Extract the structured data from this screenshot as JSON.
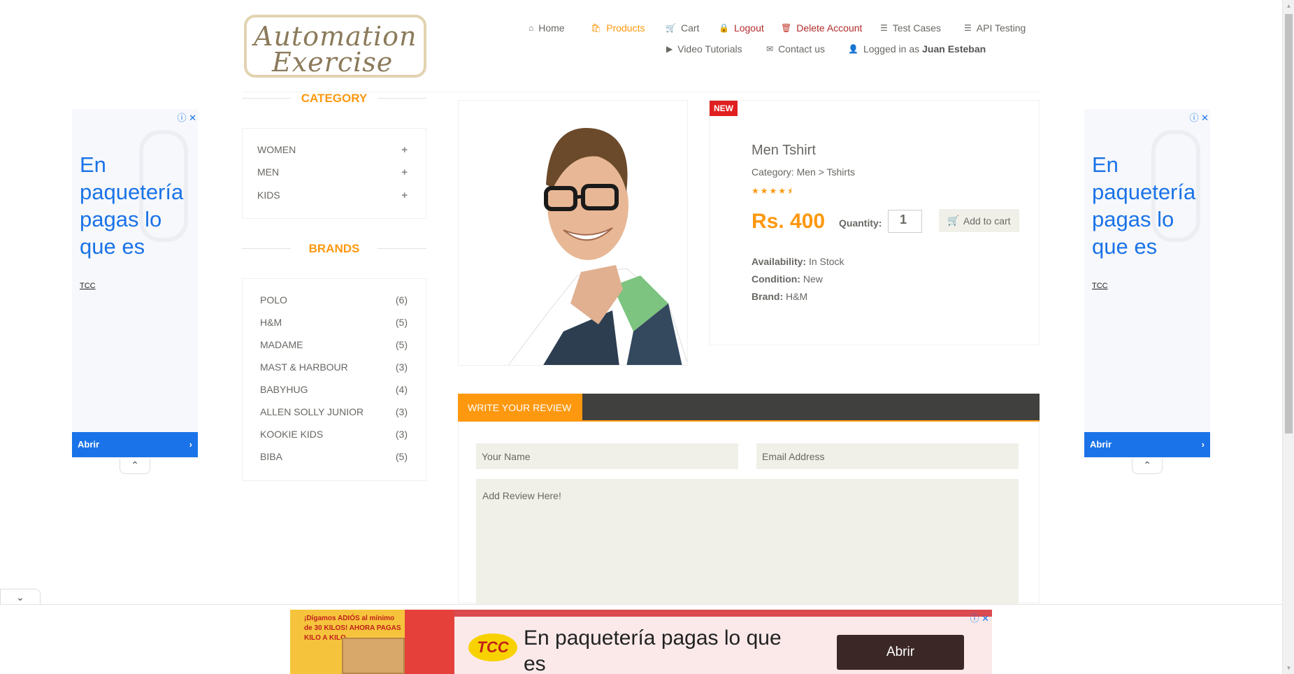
{
  "header": {
    "logo_line1": "Automation",
    "logo_line2": "Exercise",
    "nav": [
      {
        "label": "Home",
        "icon": "home-icon"
      },
      {
        "label": "Products",
        "icon": "products-icon"
      },
      {
        "label": "Cart",
        "icon": "cart-icon"
      },
      {
        "label": "Logout",
        "icon": "lock-icon"
      },
      {
        "label": "Delete Account",
        "icon": "trash-icon"
      },
      {
        "label": "Test Cases",
        "icon": "list-icon"
      },
      {
        "label": "API Testing",
        "icon": "list-icon"
      },
      {
        "label": "Video Tutorials",
        "icon": "youtube-icon"
      },
      {
        "label": "Contact us",
        "icon": "envelope-icon"
      },
      {
        "label": "Logged in as",
        "icon": "user-icon"
      }
    ],
    "username": "Juan Esteban",
    "accent_color": "#fe980f"
  },
  "sidebar": {
    "category_title": "CATEGORY",
    "categories": [
      "WOMEN",
      "MEN",
      "KIDS"
    ],
    "brands_title": "BRANDS",
    "brands": [
      {
        "name": "POLO",
        "count": "(6)"
      },
      {
        "name": "H&M",
        "count": "(5)"
      },
      {
        "name": "MADAME",
        "count": "(5)"
      },
      {
        "name": "MAST & HARBOUR",
        "count": "(3)"
      },
      {
        "name": "BABYHUG",
        "count": "(4)"
      },
      {
        "name": "ALLEN SOLLY JUNIOR",
        "count": "(3)"
      },
      {
        "name": "KOOKIE KIDS",
        "count": "(3)"
      },
      {
        "name": "BIBA",
        "count": "(5)"
      }
    ]
  },
  "product": {
    "badge": "NEW",
    "name": "Men Tshirt",
    "category": "Category: Men > Tshirts",
    "rating": 4.5,
    "price": "Rs. 400",
    "quantity_label": "Quantity:",
    "quantity": "1",
    "add_to_cart": "Add to cart",
    "availability_label": "Availability:",
    "availability": "In Stock",
    "condition_label": "Condition:",
    "condition": "New",
    "brand_label": "Brand:",
    "brand": "H&M"
  },
  "review": {
    "tab_label": "WRITE YOUR REVIEW",
    "name_placeholder": "Your Name",
    "email_placeholder": "Email Address",
    "review_placeholder": "Add Review Here!"
  },
  "ads": {
    "side_text": "En paquetería pagas lo que es",
    "side_source": "TCC",
    "side_button": "Abrir",
    "banner_text": "En paquetería pagas lo que es",
    "banner_button": "Abrir",
    "banner_brand": "TCC",
    "banner_promo": "¡Dígamos ADIÓS al mínimo de 30 KILOS! AHORA PAGAS KILO A KILO",
    "ad_color": "#1a73e8"
  }
}
